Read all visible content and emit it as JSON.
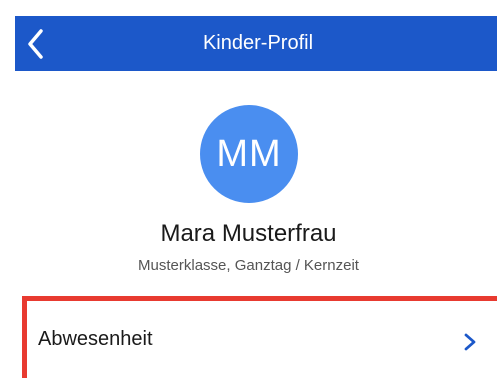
{
  "header": {
    "title": "Kinder-Profil",
    "back_icon": "chevron-left-icon",
    "color": "#1c58c9"
  },
  "profile": {
    "initials": "MM",
    "avatar_color": "#4a8ef0",
    "name": "Mara Musterfrau",
    "subtitle": "Musterklasse, Ganztag / Kernzeit"
  },
  "menu": {
    "items": [
      {
        "label": "Abwesenheit",
        "icon": "chevron-right-icon"
      }
    ],
    "highlight_color": "#e83a30"
  }
}
